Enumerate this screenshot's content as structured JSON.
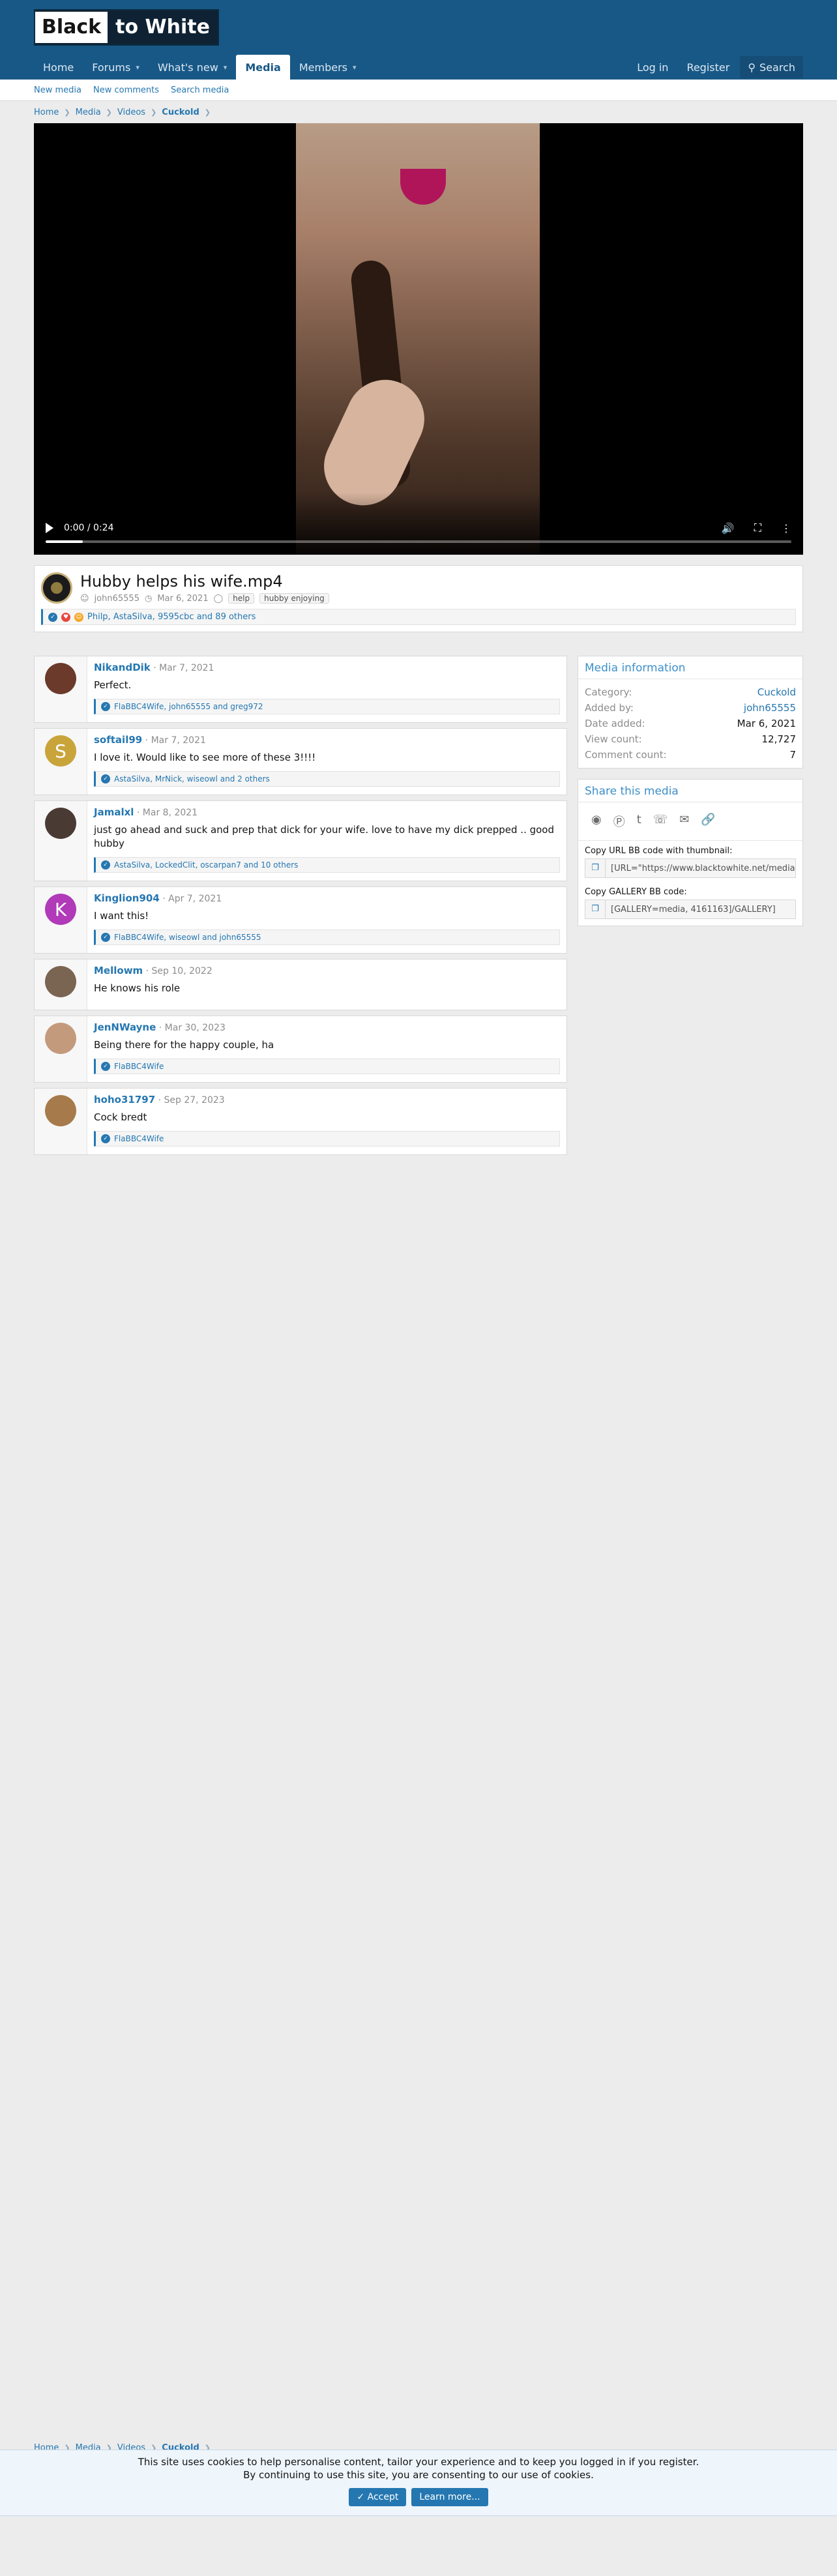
{
  "logo": {
    "left": "Black",
    "right": "to White"
  },
  "nav": {
    "tabs": [
      {
        "label": "Home",
        "chevron": false
      },
      {
        "label": "Forums",
        "chevron": true
      },
      {
        "label": "What's new",
        "chevron": true
      },
      {
        "label": "Media",
        "chevron": false,
        "active": true
      },
      {
        "label": "Members",
        "chevron": true
      }
    ],
    "login": "Log in",
    "register": "Register",
    "search": "Search"
  },
  "subnav": {
    "new_media": "New media",
    "new_comments": "New comments",
    "search_media": "Search media"
  },
  "breadcrumb": {
    "home": "Home",
    "media": "Media",
    "videos": "Videos",
    "category": "Cuckold"
  },
  "video": {
    "time": "0:00 / 0:24",
    "progress_percent": 5
  },
  "media": {
    "title": "Hubby helps his wife.mp4",
    "author": "john65555",
    "date": "Mar 6, 2021",
    "tags": [
      "help",
      "hubby enjoying"
    ],
    "reactions_text": "Philp, AstaSilva, 9595cbc and 89 others"
  },
  "comments": [
    {
      "user": "NikandDik",
      "date": "Mar 7, 2021",
      "text": "Perfect.",
      "reactions": "FlaBBC4Wife, john65555 and greg972",
      "avatar": {
        "letter": "",
        "color": "#6b3a2a"
      }
    },
    {
      "user": "softail99",
      "date": "Mar 7, 2021",
      "text": "I love it. Would like to see more of these 3!!!!",
      "reactions": "AstaSilva, MrNick, wiseowl and 2 others",
      "avatar": {
        "letter": "S",
        "color": "#c9a43a"
      }
    },
    {
      "user": "Jamalxl",
      "date": "Mar 8, 2021",
      "text": "just go ahead and suck and prep that dick for your wife. love to have my dick prepped .. good hubby",
      "reactions": "AstaSilva, LockedClit, oscarpan7 and 10 others",
      "avatar": {
        "letter": "",
        "color": "#4a3a34"
      }
    },
    {
      "user": "Kinglion904",
      "date": "Apr 7, 2021",
      "text": "I want this!",
      "reactions": "FlaBBC4Wife, wiseowl and john65555",
      "avatar": {
        "letter": "K",
        "color": "#b03ab8"
      }
    },
    {
      "user": "Mellowm",
      "date": "Sep 10, 2022",
      "text": "He knows his role",
      "reactions": "",
      "avatar": {
        "letter": "",
        "color": "#7a6452"
      }
    },
    {
      "user": "JenNWayne",
      "date": "Mar 30, 2023",
      "text": "Being there for the happy couple, ha",
      "reactions": "FlaBBC4Wife",
      "avatar": {
        "letter": "",
        "color": "#c49a7c"
      }
    },
    {
      "user": "hoho31797",
      "date": "Sep 27, 2023",
      "text": "Cock bredt",
      "reactions": "FlaBBC4Wife",
      "avatar": {
        "letter": "",
        "color": "#a67a4a"
      }
    }
  ],
  "media_info": {
    "title": "Media information",
    "rows": [
      {
        "k": "Category:",
        "v": "Cuckold",
        "link": true
      },
      {
        "k": "Added by:",
        "v": "john65555",
        "link": true
      },
      {
        "k": "Date added:",
        "v": "Mar 6, 2021",
        "link": false
      },
      {
        "k": "View count:",
        "v": "12,727",
        "link": false
      },
      {
        "k": "Comment count:",
        "v": "7",
        "link": false
      }
    ]
  },
  "share": {
    "title": "Share this media",
    "icons": [
      "reddit-icon",
      "pinterest-icon",
      "tumblr-icon",
      "whatsapp-icon",
      "email-icon",
      "link-icon"
    ],
    "copy_thumb_label": "Copy URL BB code with thumbnail:",
    "copy_thumb_value": "[URL=\"https://www.blacktowhite.net/media",
    "copy_gallery_label": "Copy GALLERY BB code:",
    "copy_gallery_value": "[GALLERY=media, 4161163]/GALLERY]"
  },
  "cookie": {
    "line1": "This site uses cookies to help personalise content, tailor your experience and to keep you logged in if you register.",
    "line2": "By continuing to use this site, you are consenting to our use of cookies.",
    "accept": "Accept",
    "learn_more": "Learn more..."
  }
}
